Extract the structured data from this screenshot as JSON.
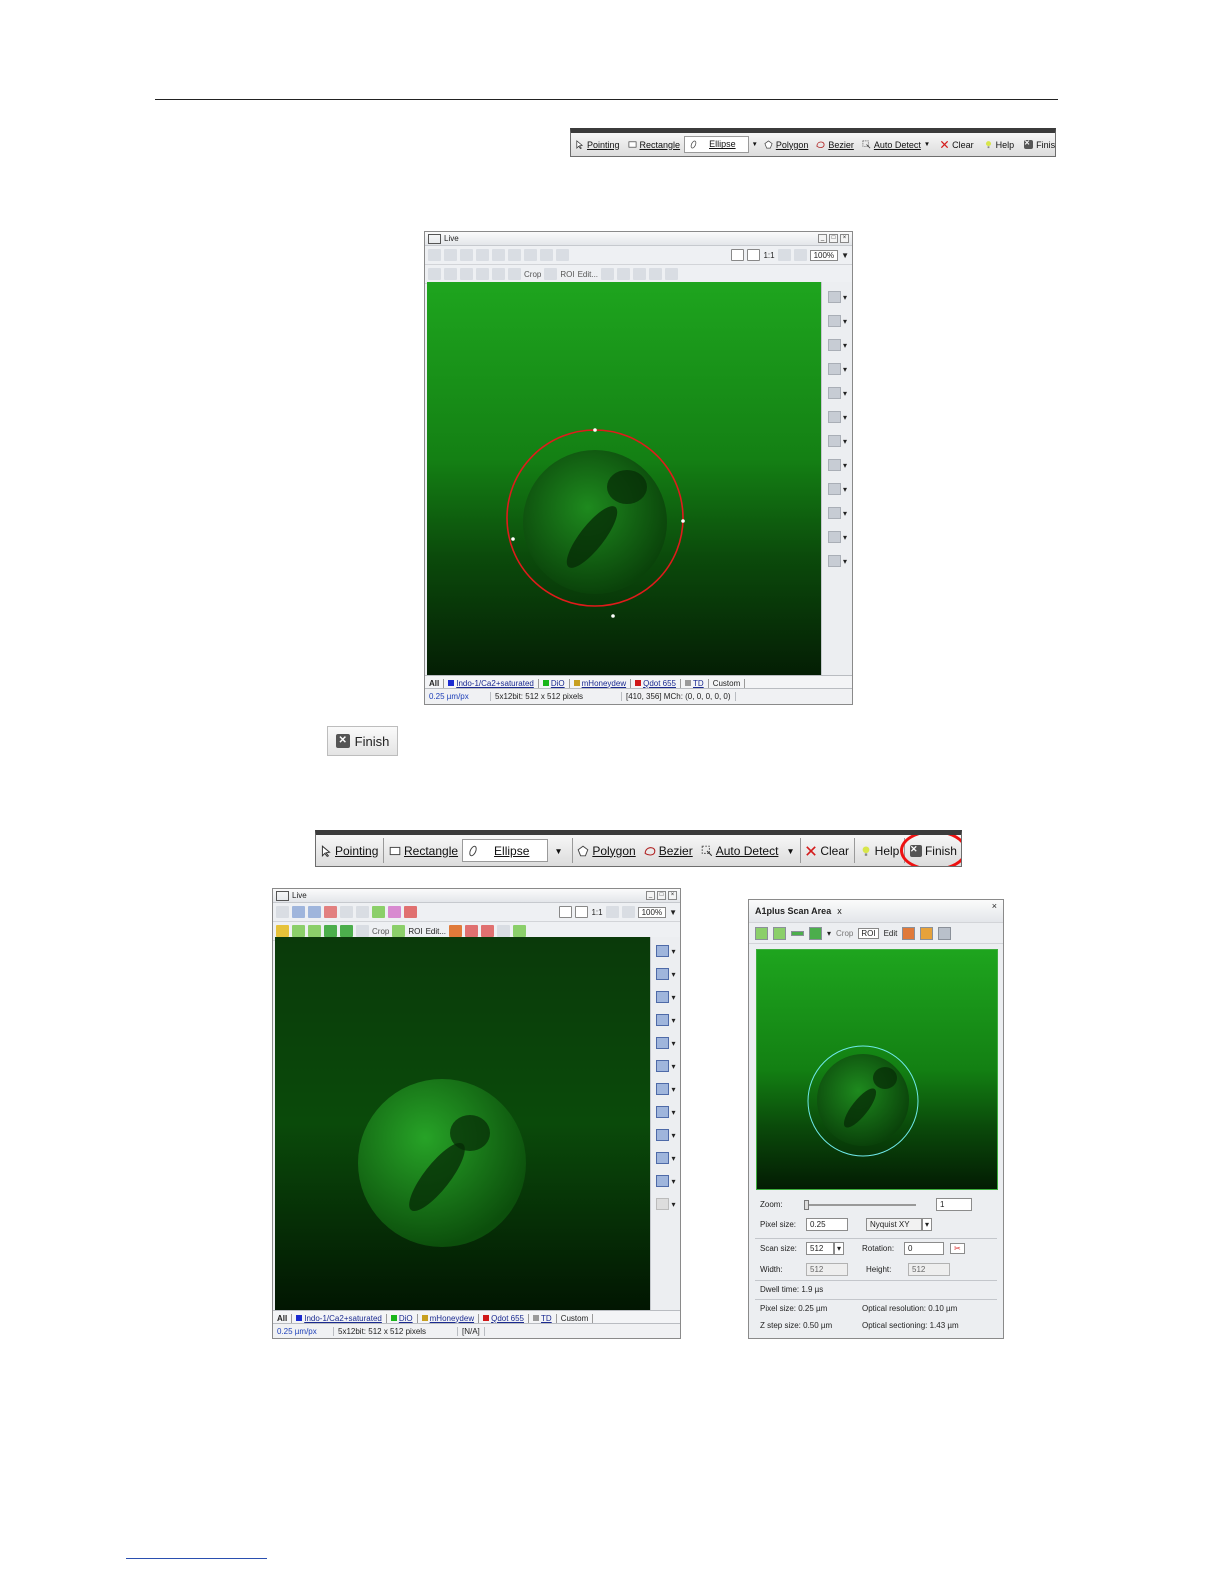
{
  "roi_toolbar": {
    "pointing": "Pointing",
    "rectangle": "Rectangle",
    "ellipse": "Ellipse",
    "polygon": "Polygon",
    "bezier": "Bezier",
    "auto_detect": "Auto Detect",
    "clear": "Clear",
    "help": "Help",
    "finish": "Finish"
  },
  "finish_button": {
    "label": "Finish"
  },
  "live_window": {
    "title": "Live",
    "zoom": "100%",
    "ratio": "1:1",
    "crop": "Crop",
    "roi": "ROI",
    "edit": "Edit...",
    "tabs": [
      "All",
      "Indo-1/Ca2+saturated",
      "DiO",
      "mHoneydew",
      "Qdot 655",
      "TD",
      "Custom"
    ],
    "channel_colors": [
      "#1a2ad0",
      "#19b619",
      "#c8a020",
      "#d01818",
      "#9a9a9a"
    ],
    "status": {
      "scale": "0.25 µm/px",
      "format": "5x12bit: 512 x 512 pixels",
      "pos_first": "[410, 356] MCh: (0, 0, 0, 0, 0)",
      "pos_second": "[N/A]"
    }
  },
  "scan_area": {
    "title": "A1plus Scan Area",
    "close": "x",
    "crop": "Crop",
    "roi": "ROI",
    "edit": "Edit",
    "zoom_label": "Zoom:",
    "zoom_value": "1",
    "zoom_level": 0.0,
    "pixel_size_label": "Pixel size:",
    "pixel_size_value": "0.25",
    "nyquist": "Nyquist XY",
    "scan_size_label": "Scan size:",
    "scan_size_value": "512",
    "rotation_label": "Rotation:",
    "rotation_value": "0",
    "width_label": "Width:",
    "width_value": "512",
    "height_label": "Height:",
    "height_value": "512",
    "dwell": "Dwell time: 1.9 µs",
    "pixel_size_info": "Pixel size: 0.25 µm",
    "optical_resolution": "Optical resolution: 0.10 µm",
    "z_step": "Z step size: 0.50 µm",
    "optical_sectioning": "Optical sectioning: 1.43 µm"
  }
}
